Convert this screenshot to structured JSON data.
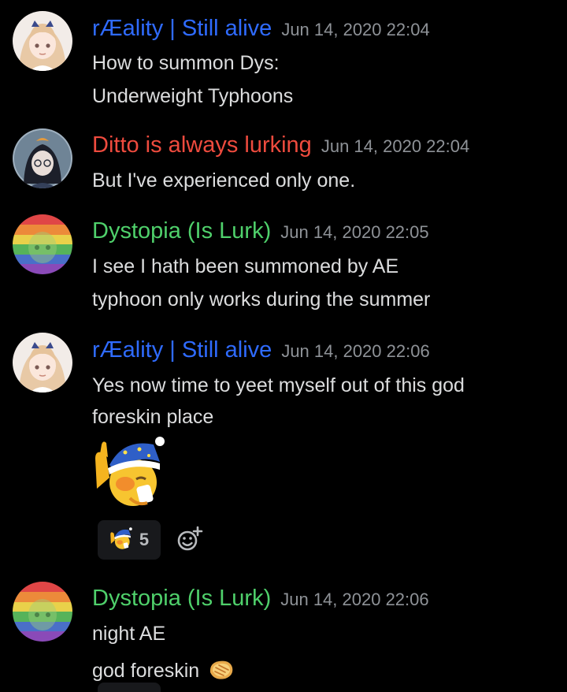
{
  "colors": {
    "background": "#000000",
    "blue_author": "#2f6bff",
    "red_author": "#ee4b3e",
    "green_author": "#4fd06b",
    "timestamp": "#8e9297",
    "text": "#dcddde"
  },
  "messages": [
    {
      "author": "rÆality | Still alive",
      "timestamp": "Jun 14, 2020 22:04",
      "lines": [
        "How to summon Dys:",
        "Underweight Typhoons"
      ]
    },
    {
      "author": "Ditto is always lurking",
      "timestamp": "Jun 14, 2020 22:04",
      "lines": [
        "But I've experienced only one."
      ]
    },
    {
      "author": "Dystopia (Is Lurk)",
      "timestamp": "Jun 14, 2020 22:05",
      "lines": [
        "I see I hath been summoned by AE",
        "typhoon only works during the summer"
      ]
    },
    {
      "author": "rÆality | Still alive",
      "timestamp": "Jun 14, 2020 22:06",
      "lines": [
        "Yes now time to yeet myself out of this god",
        "foreskin place"
      ],
      "big_emoji": "wave-goodnight-emoji",
      "reaction": {
        "emoji": "wave-goodnight-emoji",
        "count": "5"
      },
      "add_reaction_icon": "add-reaction-icon"
    },
    {
      "author": "Dystopia (Is Lurk)",
      "timestamp": "Jun 14, 2020 22:06",
      "lines": [
        "night AE",
        "god foreskin"
      ],
      "inline_emoji": "bread-emoji"
    }
  ]
}
